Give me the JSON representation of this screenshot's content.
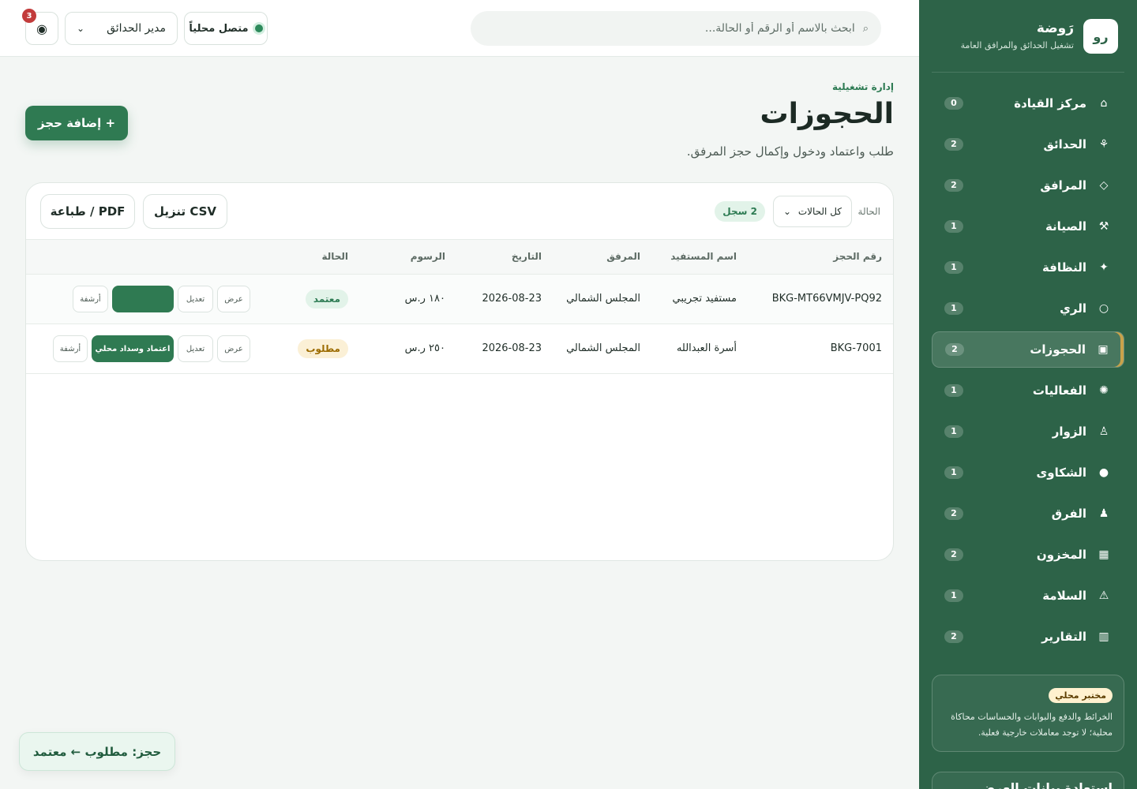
{
  "brand": {
    "logo": "رو",
    "name": "رَوضة",
    "tagline": "تشغيل الحدائق والمرافق العامة"
  },
  "nav": [
    {
      "label": "مركز القيادة",
      "icon": "⌂",
      "icon_name": "home-icon",
      "count": "0"
    },
    {
      "label": "الحدائق",
      "icon": "⚘",
      "icon_name": "flower-icon",
      "count": "2"
    },
    {
      "label": "المرافق",
      "icon": "◇",
      "icon_name": "diamond-icon",
      "count": "2"
    },
    {
      "label": "الصيانة",
      "icon": "⚒",
      "icon_name": "tools-icon",
      "count": "1"
    },
    {
      "label": "النظافة",
      "icon": "✦",
      "icon_name": "sparkle-icon",
      "count": "1"
    },
    {
      "label": "الري",
      "icon": "○",
      "icon_name": "water-drop-icon",
      "count": "1"
    },
    {
      "label": "الحجوزات",
      "icon": "▣",
      "icon_name": "calendar-icon",
      "count": "2",
      "active": true
    },
    {
      "label": "الفعاليات",
      "icon": "✺",
      "icon_name": "event-icon",
      "count": "1"
    },
    {
      "label": "الزوار",
      "icon": "♙",
      "icon_name": "visitor-icon",
      "count": "1"
    },
    {
      "label": "الشكاوى",
      "icon": "●",
      "icon_name": "complaint-icon",
      "count": "1"
    },
    {
      "label": "الفرق",
      "icon": "♟",
      "icon_name": "team-icon",
      "count": "2"
    },
    {
      "label": "المخزون",
      "icon": "▦",
      "icon_name": "inventory-icon",
      "count": "2"
    },
    {
      "label": "السلامة",
      "icon": "⚠",
      "icon_name": "warning-icon",
      "count": "1"
    },
    {
      "label": "التقارير",
      "icon": "▥",
      "icon_name": "report-icon",
      "count": "2"
    }
  ],
  "sandbox": {
    "tag": "مختبر محلي",
    "text": "الخرائط والدفع والبوابات والحساسات محاكاة محلية؛ لا توجد معاملات خارجية فعلية."
  },
  "restore_label": "استعادة بيانات العرض",
  "topbar": {
    "search_placeholder": "ابحث بالاسم أو الرقم أو الحالة...",
    "status": "متصل محلياً",
    "role": "مدير الحدائق",
    "notifications": "3"
  },
  "page": {
    "eyebrow": "إدارة تشغيلية",
    "title": "الحجوزات",
    "subtitle": "طلب واعتماد ودخول وإكمال حجز المرفق.",
    "add_button": "+ إضافة حجز"
  },
  "toolbar": {
    "filter_label": "الحالة",
    "filter_value": "كل الحالات",
    "count": "2 سجل",
    "csv": "تنزيل CSV",
    "pdf": "طباعة / PDF"
  },
  "table": {
    "headers": [
      "رقم الحجز",
      "اسم المستفيد",
      "المرفق",
      "التاريخ",
      "الرسوم",
      "الحالة"
    ],
    "rows": [
      {
        "id": "BKG-MT66VMJV-PQ92",
        "beneficiary": "مستفيد تجريبي",
        "facility": "المجلس الشمالي",
        "date": "2026-08-23",
        "fee": "١٨٠ ر.س",
        "status": "معتمد",
        "actions": {
          "view": "عرض",
          "edit": "تعديل",
          "primary": "",
          "archive": "أرشفة"
        }
      },
      {
        "id": "BKG-7001",
        "beneficiary": "أسرة العبدالله",
        "facility": "المجلس الشمالي",
        "date": "2026-08-23",
        "fee": "٢٥٠ ر.س",
        "status": "مطلوب",
        "actions": {
          "view": "عرض",
          "edit": "تعديل",
          "primary": "اعتماد وسداد محلي",
          "archive": "أرشفة"
        }
      }
    ]
  },
  "toast": "حجز: مطلوب ← معتمد",
  "colors": {
    "primary": "#2f7a52",
    "sidebar": "#2d6348",
    "accent": "#c9a24a",
    "danger": "#c23b3b"
  }
}
